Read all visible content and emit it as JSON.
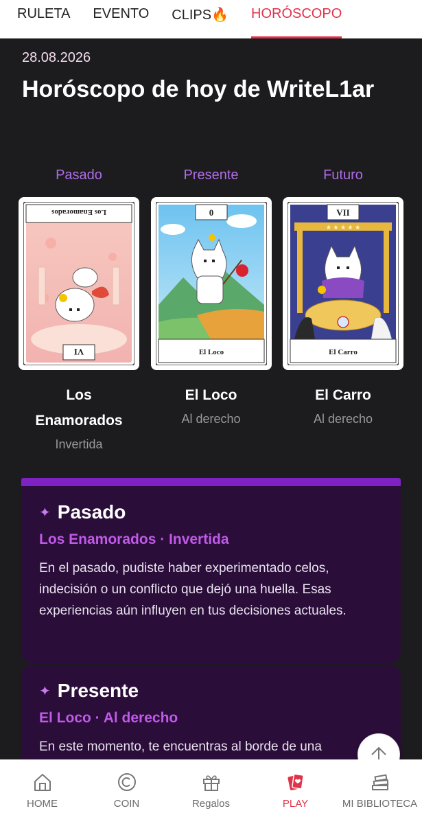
{
  "top_tabs": [
    {
      "label": "RULETA"
    },
    {
      "label": "EVENTO"
    },
    {
      "label": "CLIPS🔥"
    },
    {
      "label": "HORÓSCOPO",
      "active": true
    }
  ],
  "header": {
    "date": "28.08.2026",
    "title": "Horóscopo de hoy de WriteL1ar"
  },
  "cards": [
    {
      "position": "Pasado",
      "numeral": "VI",
      "card_caption": "Los Enamorados",
      "name": "Los Enamorados",
      "orientation": "Invertida"
    },
    {
      "position": "Presente",
      "numeral": "0",
      "card_caption": "El Loco",
      "name": "El Loco",
      "orientation": "Al derecho"
    },
    {
      "position": "Futuro",
      "numeral": "VII",
      "card_caption": "El Carro",
      "name": "El Carro",
      "orientation": "Al derecho"
    }
  ],
  "readings": [
    {
      "title": "Pasado",
      "subtitle": "Los Enamorados · Invertida",
      "text": "En el pasado, pudiste haber experimentado celos, indecisión o un conflicto que dejó una huella. Esas experiencias aún influyen en tus decisiones actuales."
    },
    {
      "title": "Presente",
      "subtitle": "El Loco · Al derecho",
      "text": "En este momento, te encuentras al borde de una"
    }
  ],
  "bottom_nav": [
    {
      "label": "HOME",
      "icon": "home-icon"
    },
    {
      "label": "COIN",
      "icon": "coin-icon"
    },
    {
      "label": "Regalos",
      "icon": "gift-icon"
    },
    {
      "label": "PLAY",
      "icon": "play-cards-icon",
      "active": true
    },
    {
      "label": "MI BIBLIOTECA",
      "icon": "library-icon"
    }
  ],
  "colors": {
    "accent": "#e0334a",
    "purple": "#b06be8",
    "section_bg": "#2b0d3a",
    "page_bg": "#1c1c1e"
  }
}
